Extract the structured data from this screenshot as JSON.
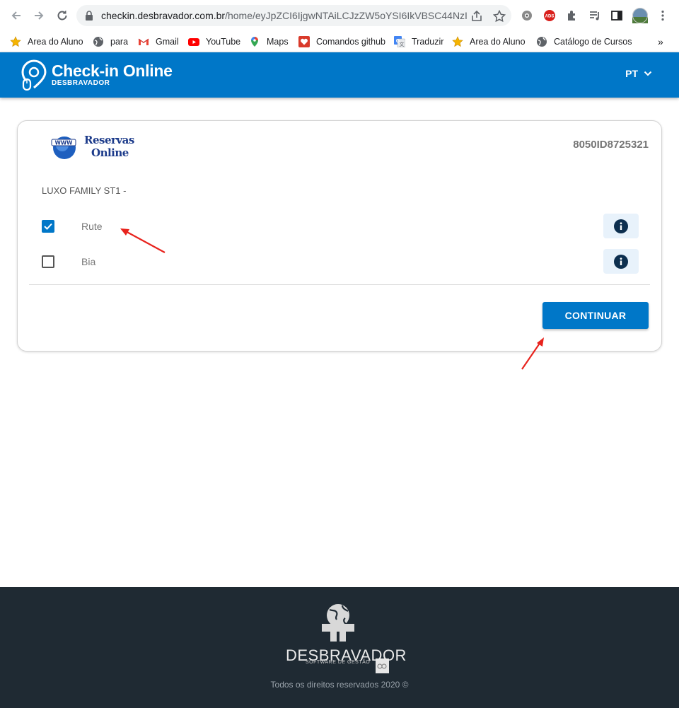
{
  "browser": {
    "url_host": "checkin.desbravador.com.br",
    "url_path": "/home/eyJpZCI6IjgwNTAiLCJzZW5oYSI6IkVBSC44NzI...",
    "bookmarks": [
      {
        "label": "Area do Aluno",
        "icon": "star-icon"
      },
      {
        "label": "para",
        "icon": "globe-icon"
      },
      {
        "label": "Gmail",
        "icon": "gmail-icon"
      },
      {
        "label": "YouTube",
        "icon": "youtube-icon"
      },
      {
        "label": "Maps",
        "icon": "maps-pin-icon"
      },
      {
        "label": "Comandos github",
        "icon": "heart-box-icon"
      },
      {
        "label": "Traduzir",
        "icon": "translate-icon"
      },
      {
        "label": "Area do Aluno",
        "icon": "star-icon"
      },
      {
        "label": "Catálogo de Cursos",
        "icon": "globe-icon"
      }
    ],
    "more_bookmarks": "»"
  },
  "header": {
    "title": "Check-in Online",
    "subtitle": "DESBRAVADOR",
    "language": "PT"
  },
  "reservation": {
    "logo_line1": "Reservas",
    "logo_line2": "Online",
    "logo_badge": "WWW",
    "id": "8050ID8725321",
    "room": "LUXO FAMILY ST1 -",
    "guests": [
      {
        "name": "Rute",
        "checked": true
      },
      {
        "name": "Bia",
        "checked": false
      }
    ],
    "continue_label": "CONTINUAR"
  },
  "footer": {
    "brand": "DESBRAVADOR",
    "brand_sub": "SOFTWARE DE GESTÃO",
    "copyright": "Todos os direitos reservados 2020 ©"
  },
  "colors": {
    "primary": "#0077c8",
    "footer_bg": "#1f2a33",
    "arrow": "#e8231d"
  }
}
